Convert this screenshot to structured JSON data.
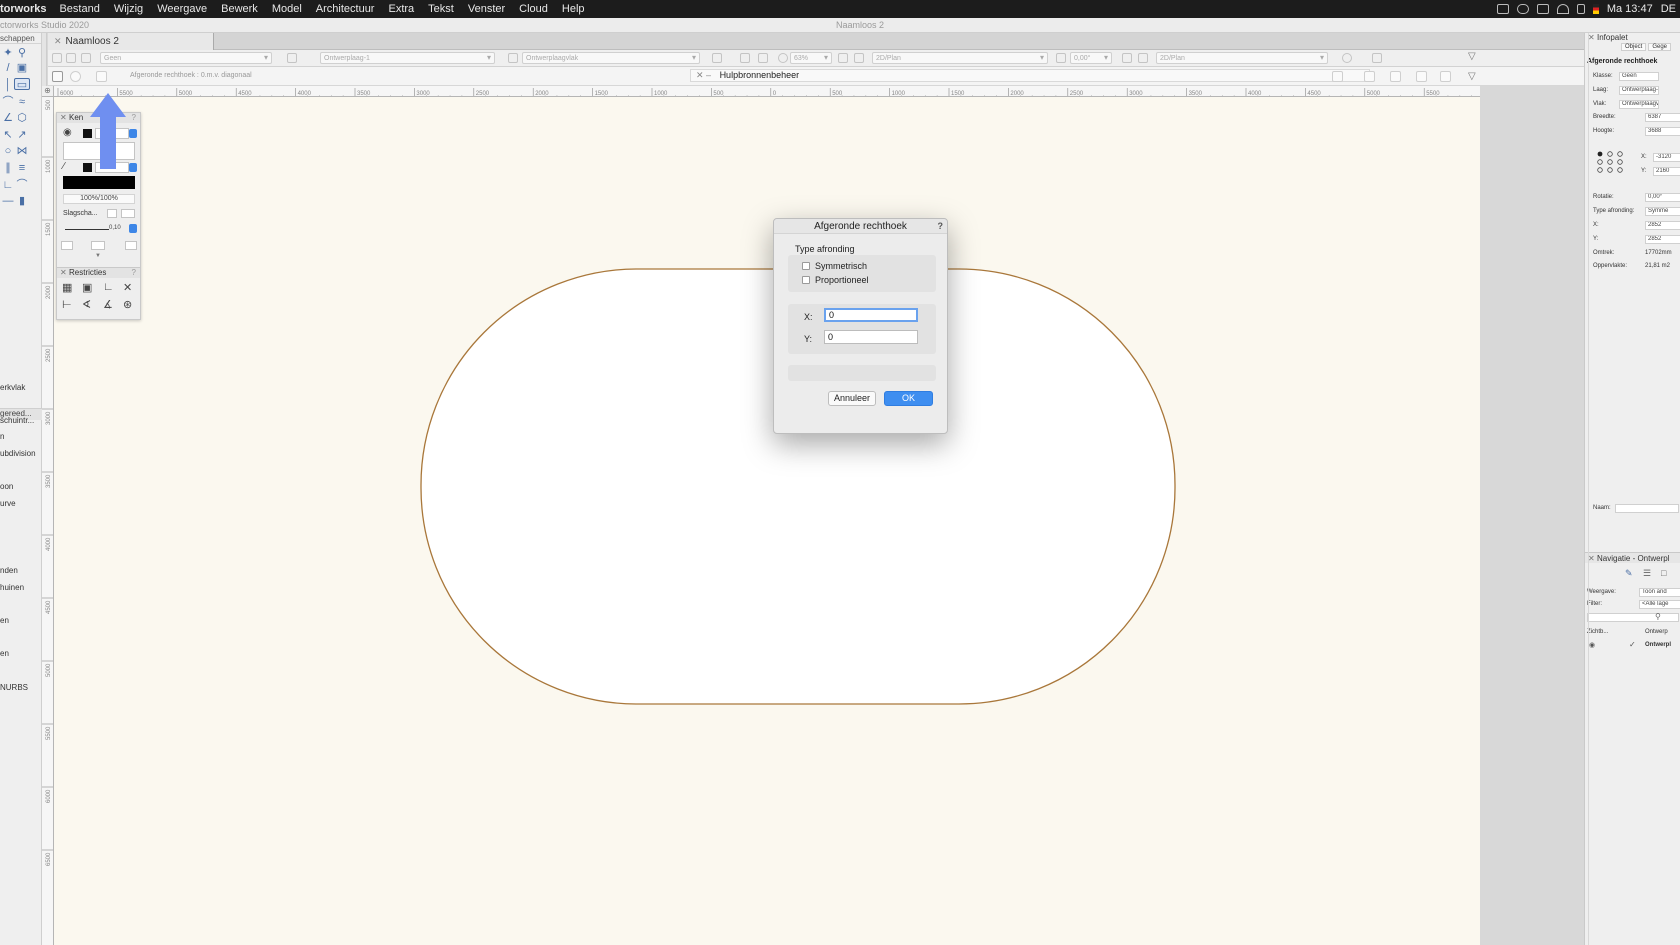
{
  "menubar": {
    "app": "torworks",
    "items": [
      "Bestand",
      "Wijzig",
      "Weergave",
      "Bewerk",
      "Model",
      "Architectuur",
      "Extra",
      "Tekst",
      "Venster",
      "Cloud",
      "Help"
    ],
    "clock": "Ma 13:47",
    "locale": "DE"
  },
  "titlebar": {
    "app_title": "ctorworks Studio 2020",
    "doc_title": "Naamloos 2"
  },
  "tools": {
    "header": "schappen",
    "group_label": "gereed...",
    "items": [
      "erkvlak",
      "schuintr...",
      "n",
      "ubdivision",
      "oon",
      "urve",
      "nden",
      "huinen",
      "en",
      "en",
      "NURBS"
    ]
  },
  "doc_tab": {
    "label": "Naamloos 2"
  },
  "viewbar": {
    "class_value": "Geen",
    "layer_value": "Ontwerplaag-1",
    "plane_value": "Ontwerplaagvlak",
    "zoom_value": "63%",
    "view_value": "2D/Plan",
    "angle_value": "0,00°",
    "projection_value": "2D/Plan"
  },
  "modebar": {
    "hint": "Afgeronde rechthoek : 0.m.v. diagonaal",
    "hulp_title": "Hulpbronnenbeheer"
  },
  "ruler": {
    "h_labels": [
      "6000",
      "5500",
      "5000",
      "4500",
      "4000",
      "3500",
      "3000",
      "2500",
      "2000",
      "1500",
      "1000",
      "500",
      "0",
      "500",
      "1000",
      "1500",
      "2000",
      "2500",
      "3000",
      "3500",
      "4000",
      "4500",
      "5000",
      "5500"
    ],
    "v_labels": [
      "500",
      "1000",
      "1500",
      "2000",
      "2500",
      "3000",
      "3500",
      "4000",
      "4500",
      "5000",
      "5500",
      "6000",
      "6500"
    ]
  },
  "attributes_palette": {
    "title": "Ken",
    "opacity": "100%/100%",
    "shadow_label": "Slagscha...",
    "line_weight": "0,10"
  },
  "restricties_palette": {
    "title": "Restricties"
  },
  "dialog": {
    "title": "Afgeronde rechthoek",
    "help": "?",
    "group_label": "Type afronding",
    "opt_symmetrisch": "Symmetrisch",
    "opt_proportioneel": "Proportioneel",
    "x_label": "X:",
    "x_value": "0",
    "y_label": "Y:",
    "y_value": "0",
    "cancel": "Annuleer",
    "ok": "OK"
  },
  "infopalet": {
    "title": "Infopalet",
    "tab_object": "Object",
    "tab_gegevens": "Gege",
    "object_type": "Afgeronde rechthoek",
    "klasse_label": "Klasse:",
    "klasse_value": "Geen",
    "laag_label": "Laag:",
    "laag_value": "Ontwerplaag-1",
    "vlak_label": "Vlak:",
    "vlak_value": "Ontwerplaagvlak",
    "breedte_label": "Breedte:",
    "breedte_value": "6387",
    "hoogte_label": "Hoogte:",
    "hoogte_value": "3688",
    "x_label": "X:",
    "x_value": "-3120",
    "y_label": "Y:",
    "y_value": "2160",
    "rotatie_label": "Rotatie:",
    "rotatie_value": "0,00°",
    "type_afr_label": "Type afronding:",
    "type_afr_value": "Symme",
    "rx_label": "X:",
    "rx_value": "2852",
    "ry_label": "Y:",
    "ry_value": "2852",
    "omtrek_label": "Omtrek:",
    "omtrek_value": "17702mm",
    "opp_label": "Oppervlakte:",
    "opp_value": "21,81 m2",
    "naam_label": "Naam:"
  },
  "navigatie": {
    "title": "Navigatie - Ontwerpl",
    "weergave_label": "Weergave:",
    "weergave_value": "Toon and",
    "filter_label": "Filter:",
    "filter_value": "<Alle lage",
    "col_zichtb": "Zichtb...",
    "col_ontwerp": "Ontwerp",
    "row_name": "Ontwerpl"
  },
  "colors": {
    "canvas": "#fbf8ef",
    "shape_stroke": "#a9773a",
    "arrow": "#6f8ff0",
    "ok_button": "#3e8ef0"
  }
}
